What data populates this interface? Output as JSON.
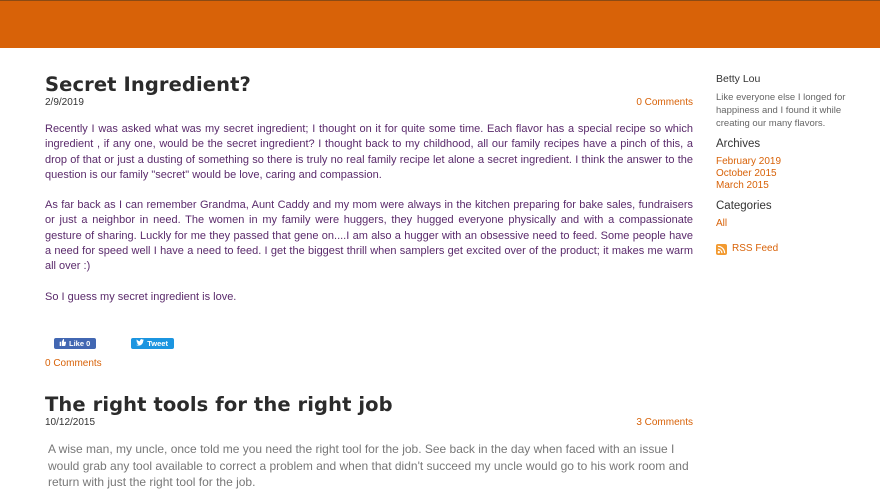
{
  "header": {
    "bar_color": "#d86208"
  },
  "post1": {
    "title": "Secret Ingredient?",
    "date": "2/9/2019",
    "comments_top": "0 Comments",
    "paragraphs": [
      "Recently I was asked what was my secret ingredient; I thought on it for quite some time.  Each flavor has a special recipe  so which ingredient , if any one, would be the secret ingredient?  I thought back to my childhood, all our family recipes have a pinch of this, a drop of that or just a dusting of something so there is truly no real family recipe let alone a secret ingredient.   I think the answer to the question is our family \"secret\" would be love, caring and compassion.",
      "As far back as I can remember Grandma, Aunt Caddy and my mom were always in the kitchen preparing for bake sales, fundraisers or just a neighbor in need. The women in my family were huggers, they hugged everyone physically and with a compassionate gesture of sharing.   Luckly for me they passed that gene on....I am also a hugger with an obsessive need to feed.  Some people have a need for speed  well I have a need to feed.  I get the biggest thrill when samplers get excited over of the product;  it makes me warm all over :)",
      "So I guess my secret ingredient is love."
    ],
    "like_label": "Like 0",
    "tweet_label": "Tweet",
    "comments_bottom": "0 Comments"
  },
  "post2": {
    "title": "The right tools for the right job",
    "date": "10/12/2015",
    "comments_top": "3 Comments",
    "paragraph": "A wise man, my uncle, once told me you need the right tool for the  job.  See back in the day when faced with an issue I would grab any tool available to correct a problem and when that didn't succeed my uncle would  go to his work room and return with just the right tool for the job."
  },
  "sidebar": {
    "author": "Betty Lou",
    "about": "Like everyone else I longed for happiness and I found it while creating our many flavors.",
    "archives_heading": "Archives",
    "archives": [
      "February 2019",
      "October 2015",
      "March 2015"
    ],
    "categories_heading": "Categories",
    "categories": [
      "All"
    ],
    "rss_label": "RSS Feed"
  },
  "colors": {
    "accent": "#d86208",
    "body_text": "#5a2a6b",
    "facebook": "#4267b2",
    "twitter": "#1b95e0"
  }
}
